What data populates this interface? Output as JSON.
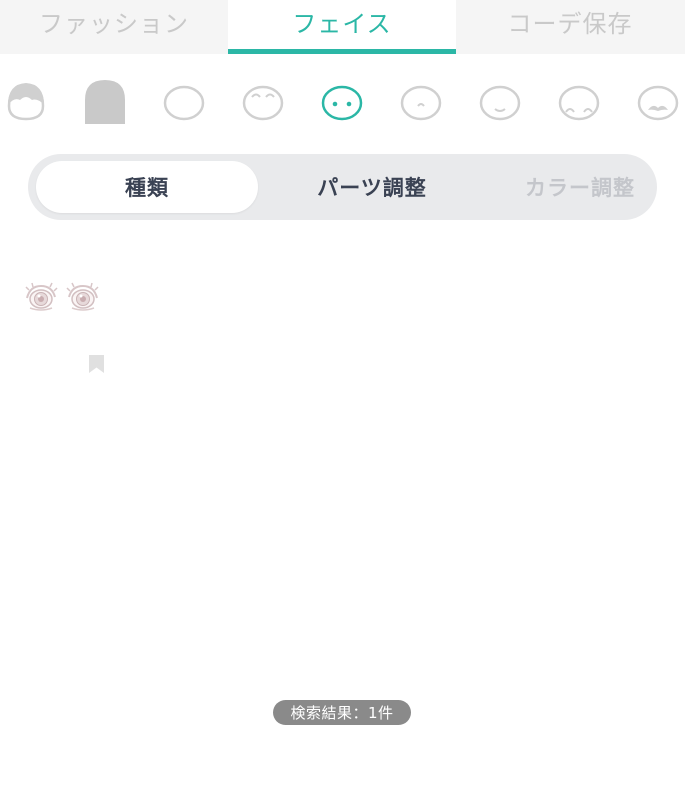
{
  "top_tabs": [
    {
      "label": "ファッション",
      "active": false
    },
    {
      "label": "フェイス",
      "active": true
    },
    {
      "label": "コーデ保存",
      "active": false
    }
  ],
  "accent_color": "#2bb7a6",
  "face_parts": [
    {
      "icon": "front-hair-icon",
      "selected": false
    },
    {
      "icon": "back-hair-icon",
      "selected": false
    },
    {
      "icon": "face-shape-icon",
      "selected": false
    },
    {
      "icon": "eyebrows-icon",
      "selected": false
    },
    {
      "icon": "eyes-icon",
      "selected": true
    },
    {
      "icon": "nose-icon",
      "selected": false
    },
    {
      "icon": "mouth-icon",
      "selected": false
    },
    {
      "icon": "cheek-icon",
      "selected": false
    },
    {
      "icon": "mustache-icon",
      "selected": false
    }
  ],
  "segment": {
    "type_label": "種類",
    "parts_adjust_label": "パーツ調整",
    "color_adjust_label": "カラー調整"
  },
  "results": {
    "items": [
      {
        "icon": "eyes-item-icon",
        "bookmarked": false
      }
    ],
    "count_label": "検索結果：1件"
  }
}
